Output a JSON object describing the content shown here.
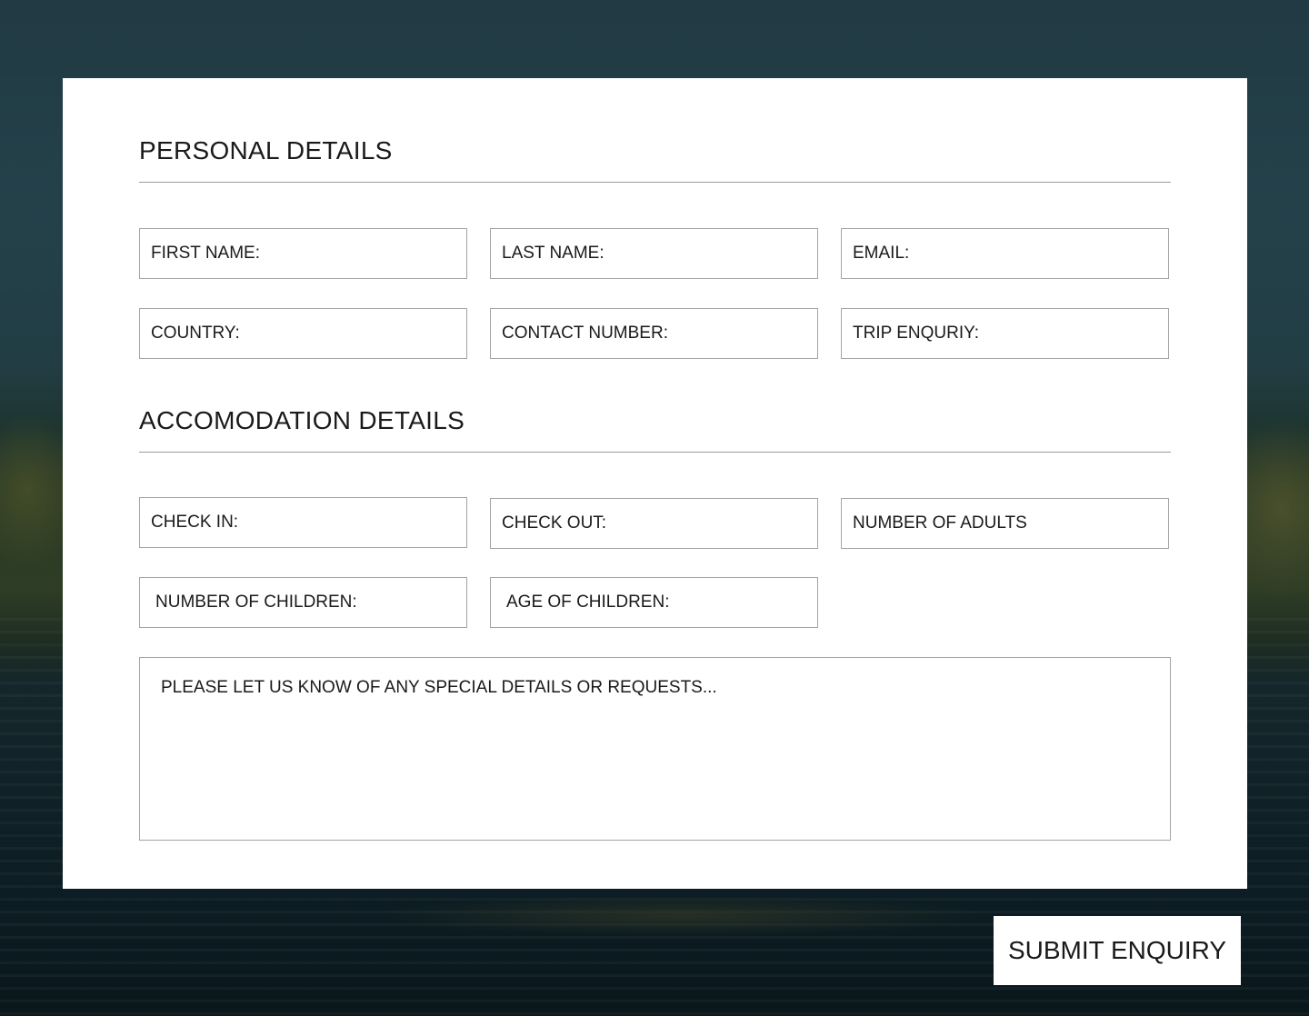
{
  "personal": {
    "title": "PERSONAL DETAILS",
    "fields": {
      "first_name": "FIRST NAME:",
      "last_name": "LAST NAME:",
      "email": "EMAIL:",
      "country": "COUNTRY:",
      "contact_number": "CONTACT NUMBER:",
      "trip_enquiry": "TRIP ENQURIY:"
    }
  },
  "accommodation": {
    "title": "ACCOMODATION DETAILS",
    "fields": {
      "check_in": "CHECK IN:",
      "check_out": "CHECK OUT:",
      "adults": "NUMBER OF ADULTS",
      "children": "NUMBER OF CHILDREN:",
      "children_age": "AGE OF CHILDREN:"
    },
    "requests_placeholder": "PLEASE LET US KNOW OF ANY SPECIAL DETAILS OR REQUESTS..."
  },
  "submit_label": "SUBMIT ENQUIRY",
  "colors": {
    "panel": "#ffffff",
    "border": "#a4a4a4",
    "text": "#1a1a1a",
    "background": "#1b3037"
  }
}
